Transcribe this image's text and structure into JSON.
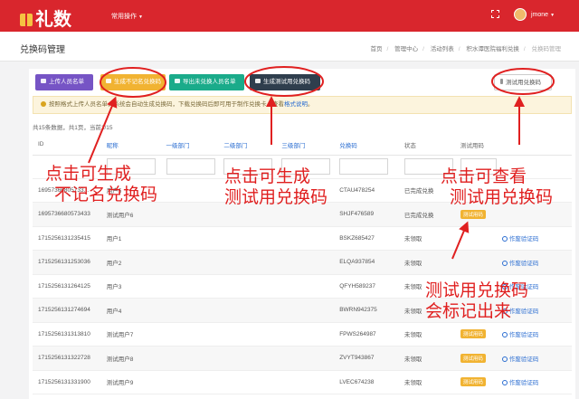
{
  "topbar": {
    "logo": "礼数",
    "menu": "常用操作",
    "username": "jmone"
  },
  "page": {
    "title": "兑换码管理",
    "breadcrumb": [
      "首页",
      "管理中心",
      "活动列表",
      "积水潭医院福利兑换",
      "兑换码管理"
    ]
  },
  "toolbar": {
    "upload": "上传人员名单",
    "generate": "生成不记名兑换码",
    "export": "导出未兑换人员名单",
    "test": "生成测试用兑换码",
    "view_test": "测试用兑换码"
  },
  "notice": {
    "text": "按照格式上传人员名单，系统会自动生成兑换码，下载兑换码后即可用于制作兑换卡，查看",
    "link": "格式说明",
    "end": "。"
  },
  "count": "共15条数据，共1页，当前1/15",
  "table": {
    "headers": [
      "ID",
      "昵称",
      "一级部门",
      "二级部门",
      "三级部门",
      "兑换码",
      "状态",
      "测试用码",
      ""
    ],
    "rows": [
      {
        "id": "16957366805733...",
        "name": "用户5",
        "code": "CTAU478254",
        "status": "已完成兑换",
        "test": "",
        "action": ""
      },
      {
        "id": "1695736680573433",
        "name": "测试用户6",
        "code": "SHJF476589",
        "status": "已完成兑换",
        "test": "测试用码",
        "action": ""
      },
      {
        "id": "1715256131235415",
        "name": "用户1",
        "code": "BSKZ685427",
        "status": "未领取",
        "test": "",
        "action": "作废验证码"
      },
      {
        "id": "1715256131253036",
        "name": "用户2",
        "code": "ELQA937854",
        "status": "未领取",
        "test": "",
        "action": "作废验证码"
      },
      {
        "id": "1715256131264125",
        "name": "用户3",
        "code": "QFYH589237",
        "status": "未领取",
        "test": "",
        "action": "作废验证码"
      },
      {
        "id": "1715256131274694",
        "name": "用户4",
        "code": "BWRN942375",
        "status": "未领取",
        "test": "",
        "action": "作废验证码"
      },
      {
        "id": "1715256131313810",
        "name": "测试用户7",
        "code": "FPWS264987",
        "status": "未领取",
        "test": "测试用码",
        "action": "作废验证码"
      },
      {
        "id": "1715256131322728",
        "name": "测试用户8",
        "code": "ZVYT943867",
        "status": "未领取",
        "test": "测试用码",
        "action": "作废验证码"
      },
      {
        "id": "1715256131331900",
        "name": "测试用户9",
        "code": "LVEC674238",
        "status": "未领取",
        "test": "测试用码",
        "action": "作废验证码"
      }
    ]
  },
  "annotations": {
    "a1_line1": "点击可生成",
    "a1_line2": "不记名兑换码",
    "a2_line1": "点击可生成",
    "a2_line2": "测试用兑换码",
    "a3_line1": "点击可查看",
    "a3_line2": "测试用兑换码",
    "a4_line1": "测试用兑换码",
    "a4_line2": "会标记出来"
  },
  "colors": {
    "brand": "#d9262d",
    "annotation": "#e02020",
    "tag": "#f1b332",
    "link": "#2a6dd1"
  }
}
